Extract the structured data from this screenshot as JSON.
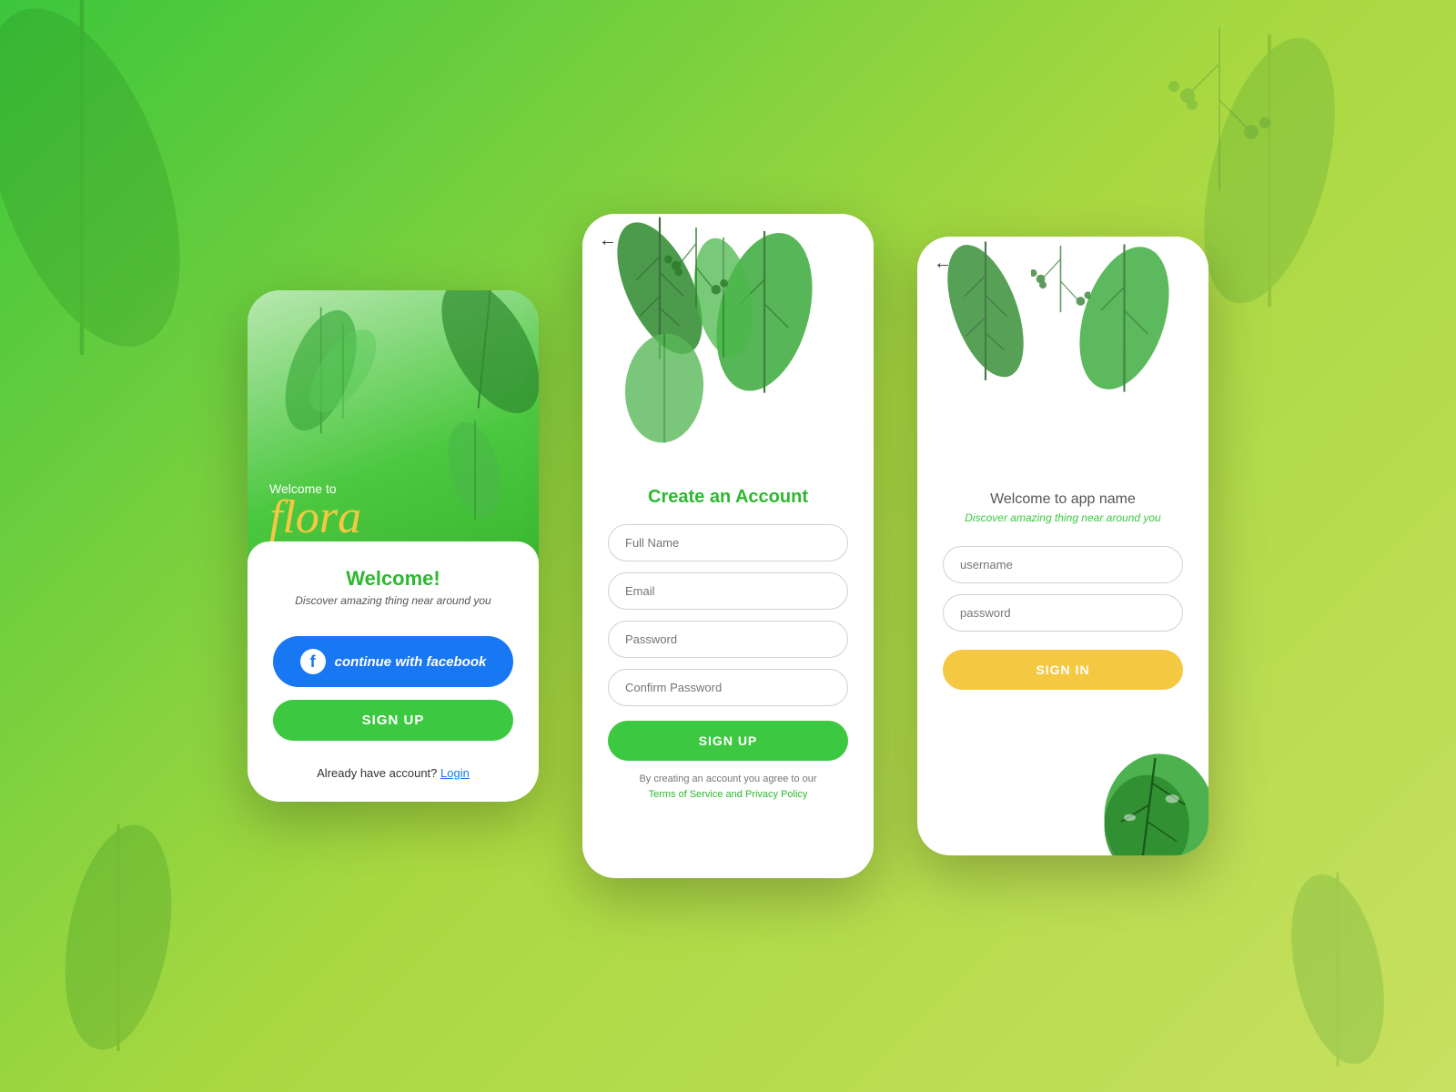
{
  "background": {
    "gradient_start": "#3cc63c",
    "gradient_end": "#c8e060"
  },
  "phone1": {
    "welcome_to": "Welcome to",
    "app_name": "flora",
    "card_title": "Welcome!",
    "card_subtitle": "Discover amazing thing near around you",
    "facebook_button": "continue with facebook",
    "signup_button": "SIGN UP",
    "already_account_text": "Already have account?",
    "login_link": "Login"
  },
  "phone2": {
    "back_arrow": "←",
    "create_account_title": "Create an Account",
    "full_name_placeholder": "Full Name",
    "email_placeholder": "Email",
    "password_placeholder": "Password",
    "confirm_password_placeholder": "Confirm Password",
    "signup_button": "SIGN UP",
    "terms_line1": "By creating an account you agree to our",
    "terms_line2": "Terms of Service and Privacy Policy"
  },
  "phone3": {
    "back_arrow": "←",
    "welcome_title": "Welcome to app name",
    "welcome_subtitle": "Discover amazing thing near around you",
    "username_placeholder": "username",
    "password_placeholder": "password",
    "signin_button": "SIGN IN"
  }
}
